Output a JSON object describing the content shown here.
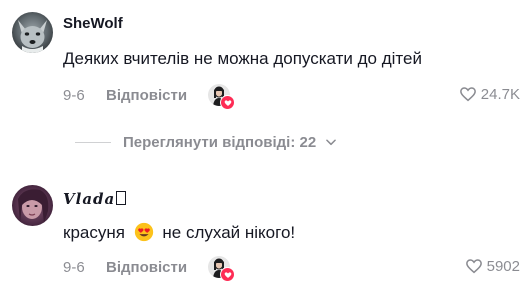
{
  "comments": [
    {
      "username": "SheWolf",
      "text": "Деяких вчителів не можна допускати до дітей",
      "date": "9-6",
      "reply_label": "Відповісти",
      "likes": "24.7K",
      "avatar_icon": "wolf-avatar",
      "creator_liked": true
    },
    {
      "username": "Vlada",
      "text_before": "красуня",
      "emoji_icon": "heart-eyes-emoji-icon",
      "text_after": "не слухай нікого!",
      "date": "9-6",
      "reply_label": "Відповісти",
      "likes": "5902",
      "avatar_icon": "girl-avatar",
      "creator_liked": true
    }
  ],
  "view_replies": {
    "label": "Переглянути відповіді: 22"
  },
  "colors": {
    "text_primary": "#161823",
    "text_secondary": "#8a8b91",
    "accent_heart": "#fe2c55"
  }
}
